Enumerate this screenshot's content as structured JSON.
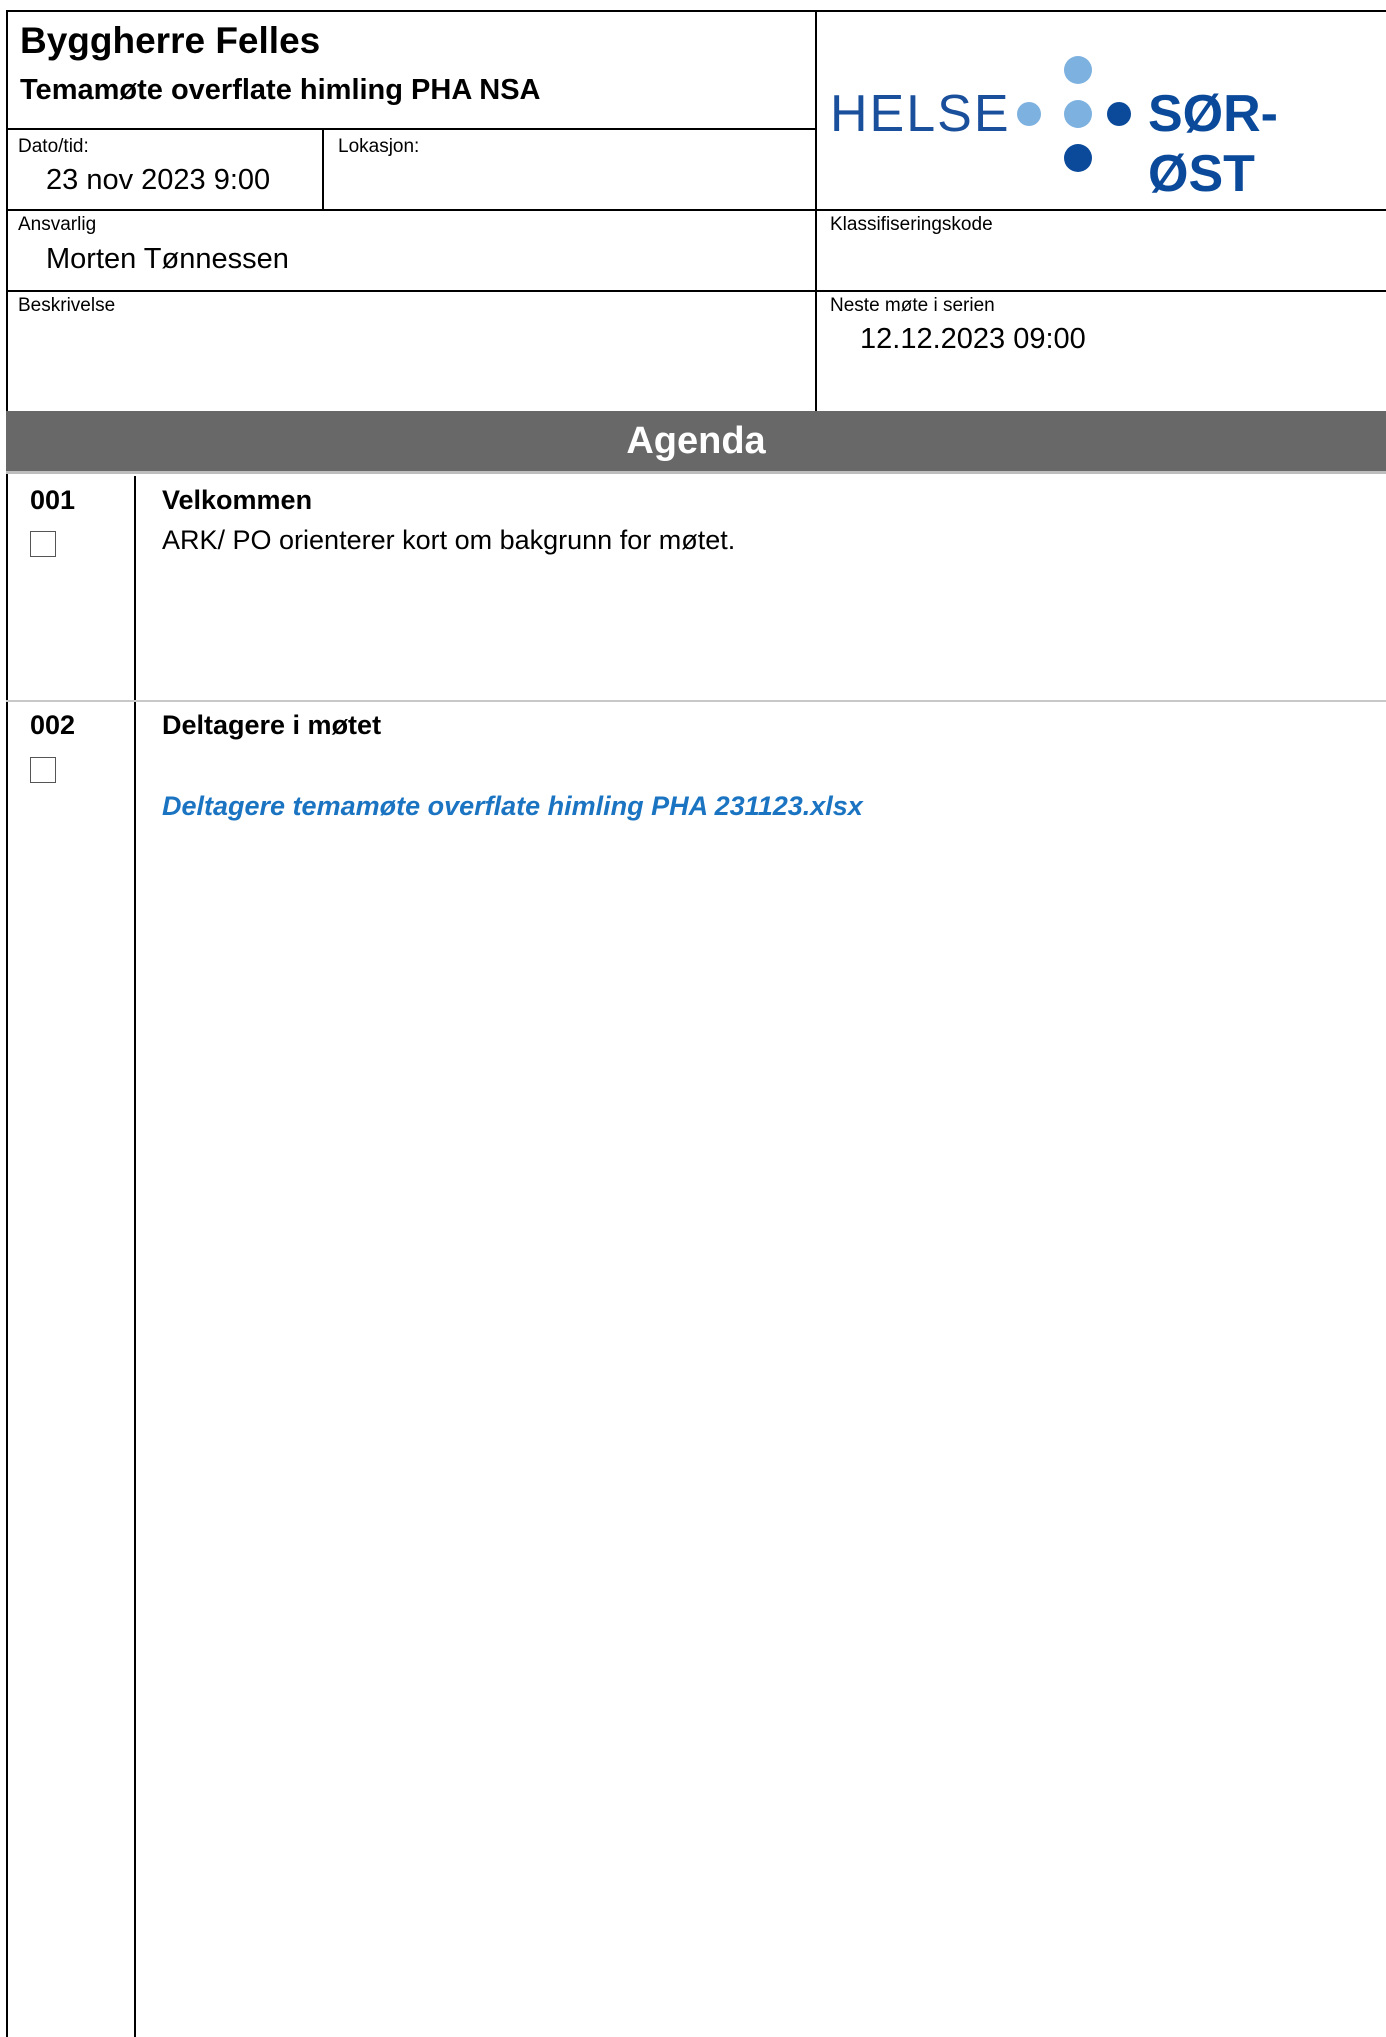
{
  "header": {
    "title": "Byggherre Felles",
    "subtitle": "Temamøte overflate himling PHA NSA",
    "logo_text_left": "HELSE",
    "logo_text_right": "SØR-ØST",
    "colors": {
      "logo_blue": "#1a4f9c",
      "logo_light_blue": "#7db1e0",
      "logo_dark_blue": "#0b4a9a"
    }
  },
  "fields": {
    "date_label": "Dato/tid:",
    "date_value": "23 nov 2023 9:00",
    "location_label": "Lokasjon:",
    "location_value": "",
    "responsible_label": "Ansvarlig",
    "responsible_value": "Morten Tønnessen",
    "classification_label": "Klassifiseringskode",
    "classification_value": "",
    "description_label": "Beskrivelse",
    "description_value": "",
    "next_meeting_label": "Neste møte i serien",
    "next_meeting_value": "12.12.2023 09:00"
  },
  "agenda": {
    "title": "Agenda",
    "items": [
      {
        "number": "001",
        "title": "Velkommen",
        "text": "ARK/ PO orienterer kort om bakgrunn for møtet.",
        "link": ""
      },
      {
        "number": "002",
        "title": "Deltagere i møtet",
        "text": "",
        "link": "Deltagere temamøte overflate himling PHA 231123.xlsx"
      }
    ]
  }
}
